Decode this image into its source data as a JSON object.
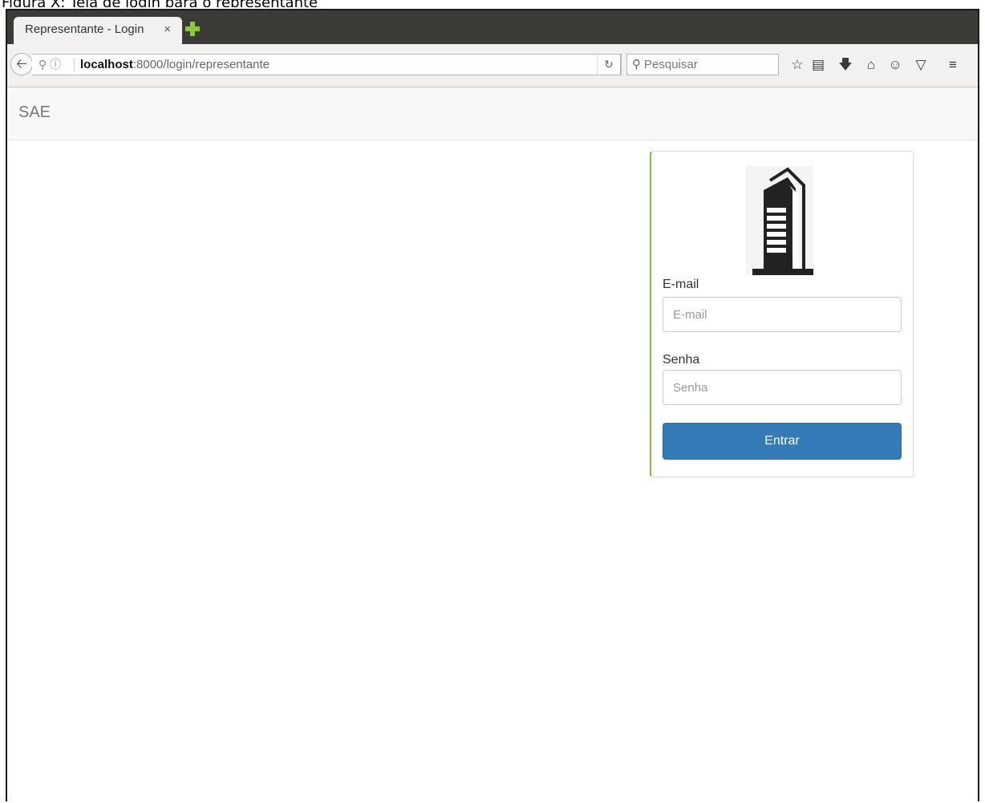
{
  "caption": "Figura X: Tela de login para o representante",
  "browser": {
    "tab_title": "Representante - Login",
    "tab_close": "×",
    "url_host": "localhost",
    "url_rest": ":8000/login/representante",
    "search_placeholder": "Pesquisar",
    "toolbar_icons": [
      "bookmark-star-icon",
      "reading-list-icon",
      "download-icon",
      "home-icon",
      "chat-icon",
      "pocket-icon",
      "menu-icon"
    ]
  },
  "app": {
    "brand": "SAE"
  },
  "login": {
    "email_label": "E-mail",
    "email_placeholder": "E-mail",
    "email_value": "",
    "password_label": "Senha",
    "password_placeholder": "Senha",
    "password_value": "",
    "submit_label": "Entrar",
    "logo_icon": "building-icon"
  },
  "colors": {
    "tab_strip": "#3c3b37",
    "panel_accent": "#8bbe3f",
    "button": "#337ab7"
  }
}
